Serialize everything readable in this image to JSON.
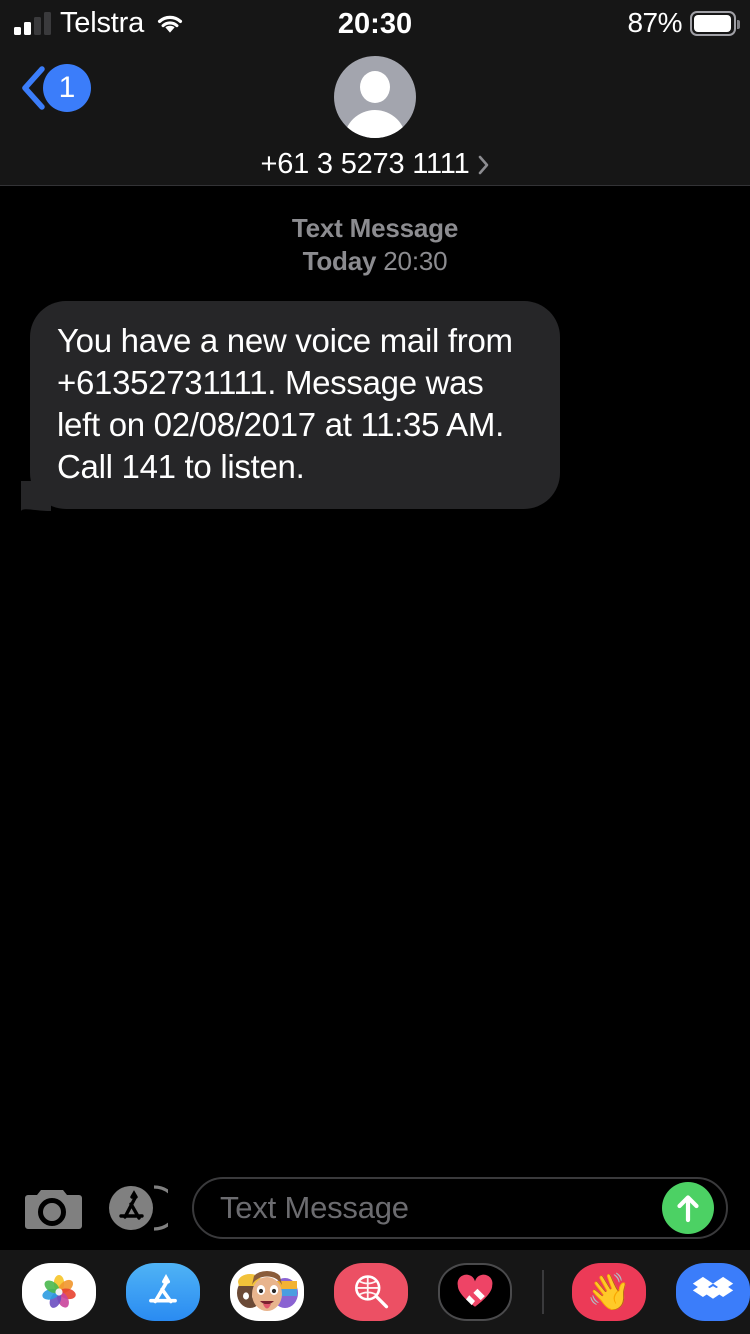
{
  "status_bar": {
    "carrier": "Telstra",
    "signal_icon": "cellular-bars-icon",
    "signal_bars_active": 2,
    "signal_bars_total": 4,
    "wifi_icon": "wifi-icon",
    "time": "20:30",
    "battery_percent": "87%",
    "battery_level": 87,
    "battery_icon": "battery-icon"
  },
  "nav": {
    "back_icon": "chevron-left-icon",
    "unread_badge": "1",
    "badge_color": "#3b7dfa",
    "avatar_icon": "person-avatar-icon",
    "contact_name": "+61 3 5273 1111",
    "details_icon": "chevron-right-icon"
  },
  "conversation": {
    "meta": {
      "kind": "Text Message",
      "day": "Today",
      "time": "20:30"
    },
    "messages": [
      {
        "sender": "incoming",
        "text": "You have a new voice mail from +61352731111. Message was left on 02/08/2017 at 11:35 AM. Call 141 to listen.",
        "bubble_color": "#262628"
      }
    ]
  },
  "input_bar": {
    "camera_icon": "camera-icon",
    "appstore_icon": "app-store-icon",
    "placeholder": "Text Message",
    "field_value": "",
    "send_icon": "arrow-up-icon",
    "send_color": "#4cd164"
  },
  "app_drawer": {
    "items": [
      {
        "name": "photos",
        "icon": "photos-icon",
        "label": "Photos"
      },
      {
        "name": "app-store",
        "icon": "app-store-icon",
        "label": "App Store"
      },
      {
        "name": "memoji",
        "icon": "memoji-icon",
        "label": "Memoji Stickers"
      },
      {
        "name": "images",
        "icon": "images-search-icon",
        "label": "#images"
      },
      {
        "name": "digital-touch",
        "icon": "digital-touch-heart-icon",
        "label": "Digital Touch"
      },
      {
        "name": "wave",
        "icon": "waving-hand-icon",
        "label": "Wave"
      },
      {
        "name": "dropbox",
        "icon": "dropbox-icon",
        "label": "Dropbox"
      }
    ]
  },
  "theme": {
    "background": "#000000",
    "chrome": "#161616",
    "bubble_incoming": "#262628",
    "accent_blue": "#3b7dfa",
    "accent_green": "#4cd164",
    "text_secondary": "#8c8c90"
  }
}
